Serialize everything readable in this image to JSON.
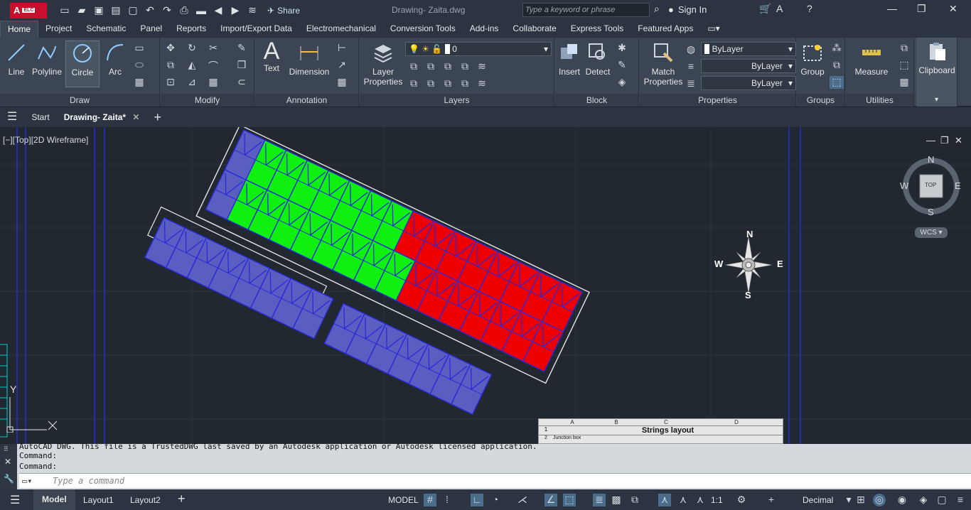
{
  "titlebar": {
    "app_logo": "A",
    "app_badge": "ELC",
    "share_label": "Share",
    "document_title": "Drawing- Zaita.dwg",
    "search_placeholder": "Type a keyword or phrase",
    "signin_label": "Sign In"
  },
  "ribbon_tabs": [
    "Home",
    "Project",
    "Schematic",
    "Panel",
    "Reports",
    "Import/Export Data",
    "Electromechanical",
    "Conversion Tools",
    "Add-ins",
    "Collaborate",
    "Express Tools",
    "Featured Apps"
  ],
  "ribbon": {
    "draw": {
      "title": "Draw",
      "line": "Line",
      "polyline": "Polyline",
      "circle": "Circle",
      "arc": "Arc"
    },
    "modify": {
      "title": "Modify"
    },
    "annotation": {
      "title": "Annotation",
      "text": "Text",
      "dimension": "Dimension"
    },
    "layers": {
      "title": "Layers",
      "layer_properties_1": "Layer",
      "layer_properties_2": "Properties",
      "current_layer": "0"
    },
    "block": {
      "title": "Block",
      "insert": "Insert",
      "detect": "Detect"
    },
    "properties": {
      "title": "Properties",
      "match_1": "Match",
      "match_2": "Properties",
      "color": "ByLayer",
      "linetype": "ByLayer",
      "lineweight": "ByLayer"
    },
    "groups": {
      "title": "Groups",
      "group": "Group"
    },
    "utilities": {
      "title": "Utilities",
      "measure": "Measure"
    },
    "clipboard": {
      "title": "Clipboard"
    }
  },
  "filetabs": {
    "start": "Start",
    "drawing": "Drawing- Zaita*"
  },
  "viewport": {
    "label": "[−][Top][2D Wireframe]",
    "viewcube_top": "TOP",
    "compass_n": "N",
    "compass_s": "S",
    "compass_e": "E",
    "compass_w": "W",
    "wcs": "WCS",
    "ucs_y": "Y",
    "rose_n": "N",
    "rose_s": "S",
    "rose_e": "E",
    "rose_w": "W",
    "table_title": "Strings layout",
    "table_cols": [
      "A",
      "B",
      "C",
      "D"
    ],
    "table_rows": [
      "1",
      "2"
    ],
    "table_cell_1": "Junction box"
  },
  "command": {
    "history_1": "AutoCAD DWG.  This file is a TrustedDWG last saved by an Autodesk application or Autodesk licensed application.",
    "history_2": "Command:",
    "history_3": "Command:",
    "input_placeholder": "Type a command"
  },
  "status": {
    "model_tab": "Model",
    "layout1": "Layout1",
    "layout2": "Layout2",
    "model_label": "MODEL",
    "scale": "1:1",
    "units": "Decimal"
  },
  "colors": {
    "green": "#10f010",
    "red": "#ee0000",
    "blue": "#5a5ec0",
    "outline": "#2a2ad8"
  }
}
